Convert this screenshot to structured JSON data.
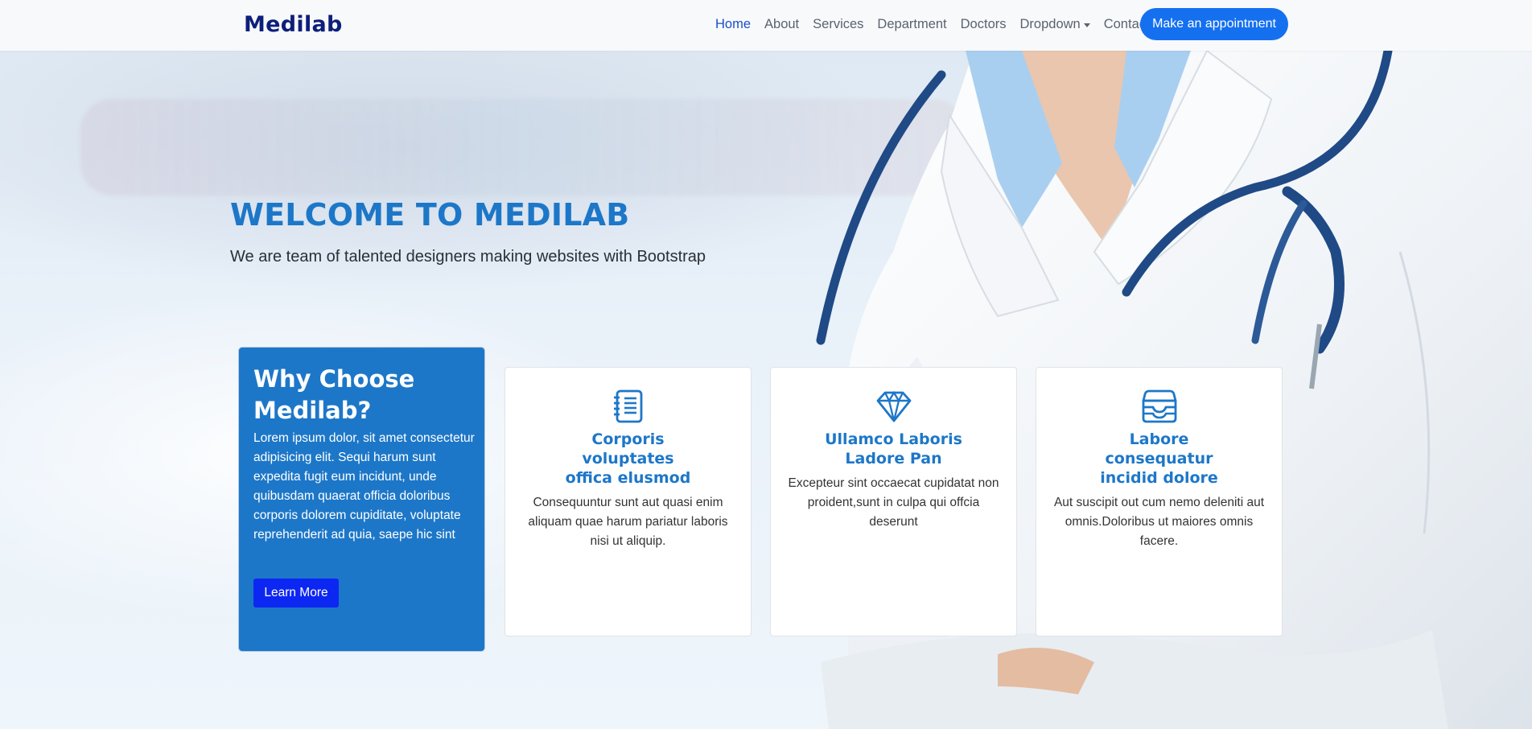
{
  "header": {
    "logo": "Medilab",
    "nav": [
      {
        "label": "Home",
        "active": true
      },
      {
        "label": "About"
      },
      {
        "label": "Services"
      },
      {
        "label": "Department"
      },
      {
        "label": "Doctors"
      },
      {
        "label": "Dropdown",
        "has_caret": true
      },
      {
        "label": "Contact"
      }
    ],
    "appointment_label": "Make an appointment"
  },
  "hero": {
    "title": "WELCOME TO MEDILAB",
    "subtitle": "We are team of talented designers making websites with Bootstrap"
  },
  "why": {
    "title": "Why Choose Medilab?",
    "text": "Lorem ipsum dolor, sit amet consectetur adipisicing elit. Sequi harum sunt expedita fugit eum incidunt, unde quibusdam quaerat officia doloribus corporis dolorem cupiditate, voluptate reprehenderit ad quia, saepe hic sint",
    "button": "Learn More"
  },
  "cards": [
    {
      "icon": "notebook-icon",
      "title": "Corporis\nvoluptates\noffica elusmod",
      "text": "Consequuntur sunt aut quasi enim aliquam quae harum pariatur laboris nisi ut aliquip."
    },
    {
      "icon": "diamond-icon",
      "title": "Ullamco Laboris\nLadore Pan",
      "text": "Excepteur sint occaecat cupidatat non proident,sunt in culpa qui offcia deserunt"
    },
    {
      "icon": "inbox-icon",
      "title": "Labore\nconsequatur\nincidid dolore",
      "text": "Aut suscipit out cum nemo deleniti aut omnis.Doloribus ut maiores omnis facere."
    }
  ],
  "colors": {
    "brand": "#1d77c8",
    "button": "#1570f0",
    "logo": "#0d1f7a"
  }
}
